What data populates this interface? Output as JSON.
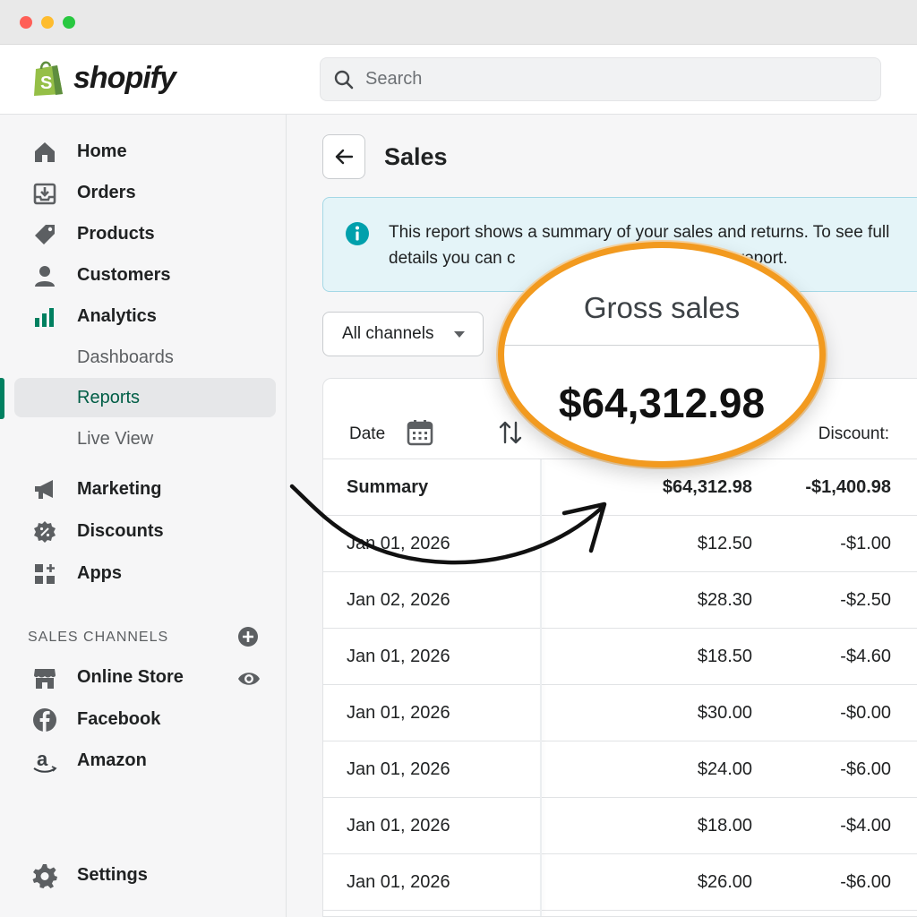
{
  "window": {
    "controls": [
      "close",
      "minimize",
      "maximize"
    ]
  },
  "brand": {
    "name": "shopify",
    "color": "#95bf47"
  },
  "search": {
    "placeholder": "Search"
  },
  "sidebar": {
    "items": [
      {
        "label": "Home",
        "icon": "home-icon"
      },
      {
        "label": "Orders",
        "icon": "orders-icon"
      },
      {
        "label": "Products",
        "icon": "tag-icon"
      },
      {
        "label": "Customers",
        "icon": "person-icon"
      },
      {
        "label": "Analytics",
        "icon": "bar-chart-icon"
      },
      {
        "label": "Dashboards"
      },
      {
        "label": "Reports",
        "active": true
      },
      {
        "label": "Live View"
      },
      {
        "label": "Marketing",
        "icon": "megaphone-icon"
      },
      {
        "label": "Discounts",
        "icon": "discount-icon"
      },
      {
        "label": "Apps",
        "icon": "apps-icon"
      }
    ],
    "sales_channels_heading": "SALES CHANNELS",
    "channels": [
      {
        "label": "Online Store",
        "icon": "store-icon"
      },
      {
        "label": "Facebook",
        "icon": "facebook-icon"
      },
      {
        "label": "Amazon",
        "icon": "amazon-icon"
      }
    ],
    "settings": {
      "label": "Settings",
      "icon": "gear-icon"
    },
    "accent_color": "#008060"
  },
  "page": {
    "title": "Sales",
    "banner": {
      "text": "This report shows a summary of your sales and returns. To see full details you can c                                    pecific report."
    },
    "channel_filter": {
      "value": "All channels"
    }
  },
  "table": {
    "columns": {
      "date": "Date",
      "discounts": "Discount:"
    },
    "summary": {
      "label": "Summary",
      "gross": "$64,312.98",
      "discounts": "-$1,400.98"
    },
    "rows": [
      {
        "date": "Jan 01, 2026",
        "gross": "$12.50",
        "discounts": "-$1.00"
      },
      {
        "date": "Jan 02, 2026",
        "gross": "$28.30",
        "discounts": "-$2.50"
      },
      {
        "date": "Jan 01, 2026",
        "gross": "$18.50",
        "discounts": "-$4.60"
      },
      {
        "date": "Jan 01, 2026",
        "gross": "$30.00",
        "discounts": "-$0.00"
      },
      {
        "date": "Jan 01, 2026",
        "gross": "$24.00",
        "discounts": "-$6.00"
      },
      {
        "date": "Jan 01, 2026",
        "gross": "$18.00",
        "discounts": "-$4.00"
      },
      {
        "date": "Jan 01, 2026",
        "gross": "$26.00",
        "discounts": "-$6.00"
      }
    ]
  },
  "callout": {
    "label": "Gross sales",
    "value": "$64,312.98",
    "ring_color": "#f29a1f"
  }
}
